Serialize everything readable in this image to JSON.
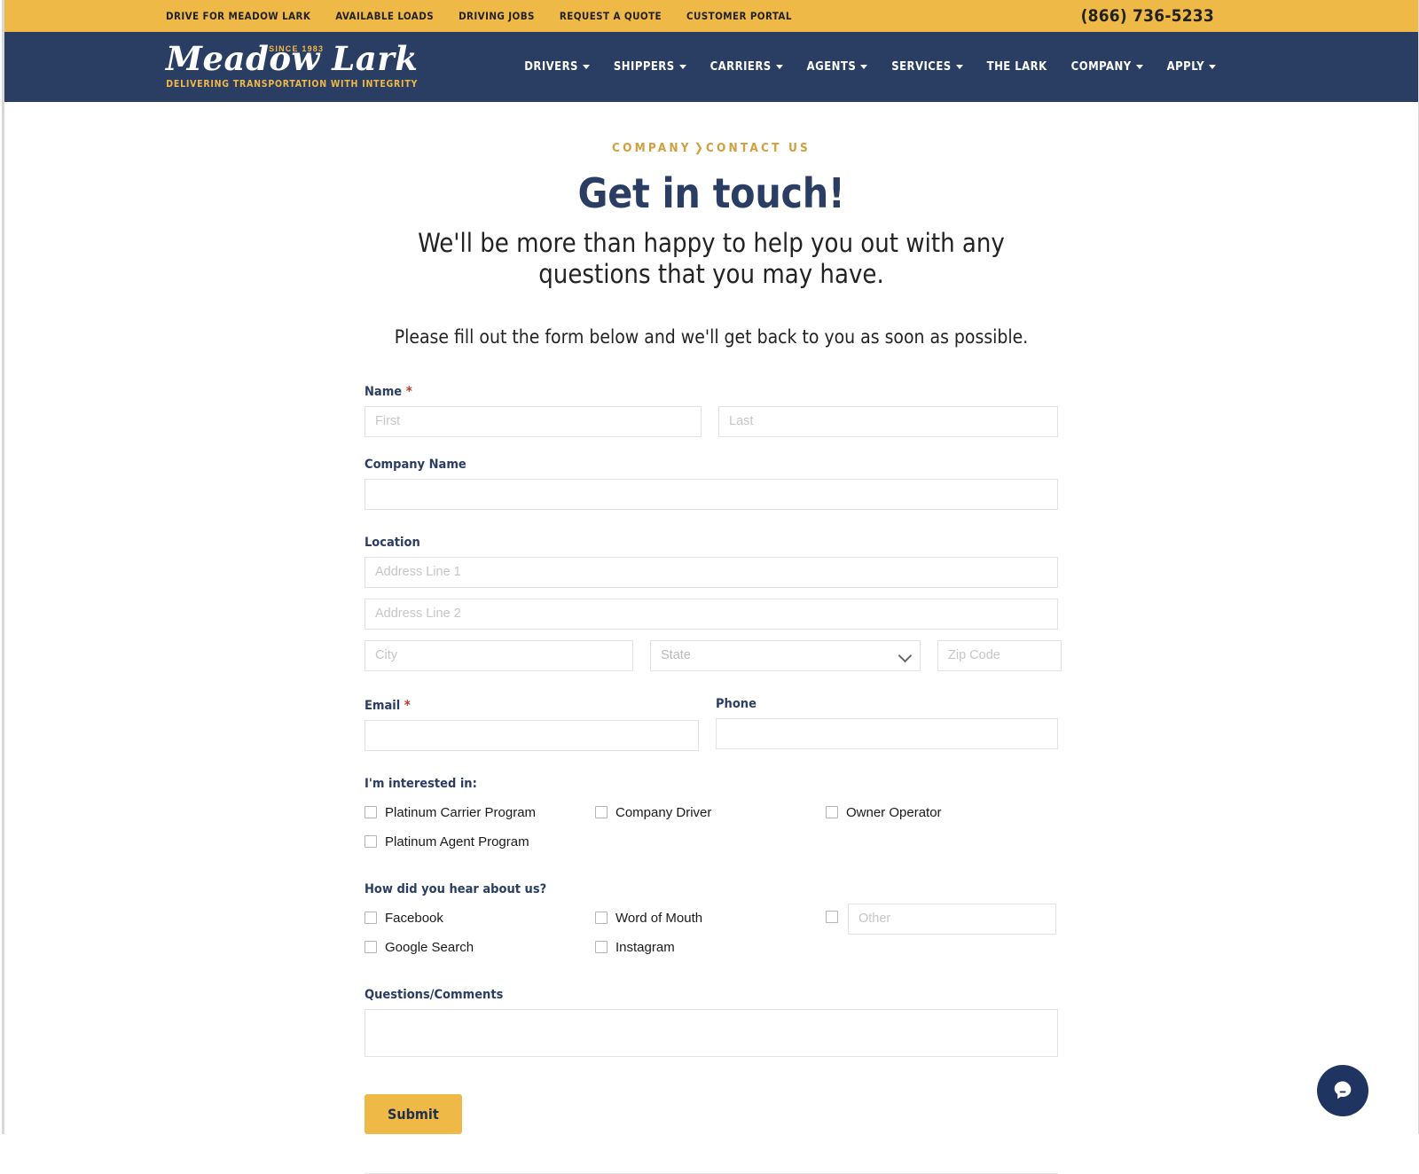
{
  "topbar": {
    "links": [
      {
        "label": "DRIVE FOR MEADOW LARK"
      },
      {
        "label": "AVAILABLE LOADS"
      },
      {
        "label": "DRIVING JOBS"
      },
      {
        "label": "REQUEST A QUOTE"
      },
      {
        "label": "CUSTOMER PORTAL"
      }
    ],
    "phone": "(866) 736-5233",
    "background": "#efb948"
  },
  "header": {
    "background": "#2a3d63",
    "logo": {
      "since": "SINCE 1983",
      "name": "Meadow Lark",
      "tagline": "DELIVERING TRANSPORTATION WITH INTEGRITY"
    },
    "nav": [
      {
        "label": "DRIVERS",
        "has_dropdown": true
      },
      {
        "label": "SHIPPERS",
        "has_dropdown": true
      },
      {
        "label": "CARRIERS",
        "has_dropdown": true
      },
      {
        "label": "AGENTS",
        "has_dropdown": true
      },
      {
        "label": "SERVICES",
        "has_dropdown": true
      },
      {
        "label": "THE LARK",
        "has_dropdown": false
      },
      {
        "label": "COMPANY",
        "has_dropdown": true
      },
      {
        "label": "APPLY",
        "has_dropdown": true
      }
    ]
  },
  "hero": {
    "breadcrumb_parent": "COMPANY",
    "breadcrumb_sep": "❯",
    "breadcrumb_current": "CONTACT US",
    "title": "Get in touch!",
    "subtitle": "We'll be more than happy to help you out with any questions that you may have.",
    "instruction": "Please fill out the form below and we'll get back to you as soon as possible.",
    "title_color": "#2a3d63",
    "breadcrumb_color": "#d1a03c"
  },
  "form": {
    "name": {
      "label": "Name",
      "required_mark": "*",
      "first_placeholder": "First",
      "last_placeholder": "Last",
      "first_value": "",
      "last_value": ""
    },
    "company": {
      "label": "Company Name",
      "placeholder": "",
      "value": ""
    },
    "location": {
      "label": "Location",
      "address1_placeholder": "Address Line 1",
      "address2_placeholder": "Address Line 2",
      "city_placeholder": "City",
      "state_placeholder": "State",
      "zip_placeholder": "Zip Code",
      "address1_value": "",
      "address2_value": "",
      "city_value": "",
      "zip_value": ""
    },
    "email": {
      "label": "Email",
      "required_mark": "*",
      "value": ""
    },
    "phone": {
      "label": "Phone",
      "value": ""
    },
    "interested": {
      "label": "I'm interested in:",
      "options": [
        {
          "label": "Platinum Carrier Program",
          "checked": false
        },
        {
          "label": "Company Driver",
          "checked": false
        },
        {
          "label": "Owner Operator",
          "checked": false
        },
        {
          "label": "Platinum Agent Program",
          "checked": false
        }
      ]
    },
    "hear_about": {
      "label": "How did you hear about us?",
      "options": [
        {
          "label": "Facebook",
          "checked": false
        },
        {
          "label": "Word of Mouth",
          "checked": false
        },
        {
          "label": "Google Search",
          "checked": false
        },
        {
          "label": "Instagram",
          "checked": false
        }
      ],
      "other_placeholder": "Other",
      "other_value": "",
      "other_checked": false
    },
    "comments": {
      "label": "Questions/Comments",
      "value": ""
    },
    "submit_label": "Submit",
    "submit_color": "#efb948"
  },
  "chat": {
    "name": "chat-widget",
    "color": "#1f3461"
  }
}
